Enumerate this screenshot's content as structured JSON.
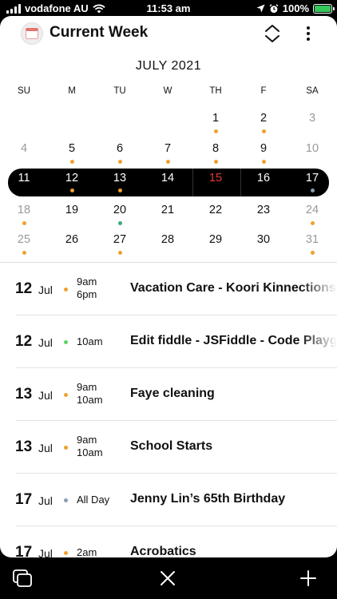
{
  "status": {
    "carrier": "vodafone AU",
    "time": "11:53 am",
    "battery": "100%",
    "battery_level": 1.0
  },
  "header": {
    "title": "Current Week",
    "icons": [
      "calendar-app-icon",
      "expand-collapse-icon",
      "more-vertical-icon"
    ]
  },
  "calendar": {
    "month_title": "JULY 2021",
    "weekdays": [
      "SU",
      "M",
      "TU",
      "W",
      "TH",
      "F",
      "SA"
    ],
    "weeks": [
      [
        null,
        null,
        null,
        null,
        {
          "d": "1",
          "dot": "orange"
        },
        {
          "d": "2",
          "dot": "orange"
        },
        {
          "d": "3",
          "muted": true
        }
      ],
      [
        {
          "d": "4",
          "muted": true
        },
        {
          "d": "5",
          "dot": "orange"
        },
        {
          "d": "6",
          "dot": "orange"
        },
        {
          "d": "7",
          "dot": "orange"
        },
        {
          "d": "8",
          "dot": "orange"
        },
        {
          "d": "9",
          "dot": "orange"
        },
        {
          "d": "10",
          "muted": true
        }
      ],
      [
        {
          "d": "11"
        },
        {
          "d": "12",
          "dot": "orange"
        },
        {
          "d": "13",
          "dot": "orange"
        },
        {
          "d": "14"
        },
        {
          "d": "15",
          "today": true
        },
        {
          "d": "16"
        },
        {
          "d": "17",
          "dot": "gray"
        }
      ],
      [
        {
          "d": "18",
          "muted": true,
          "dot": "orange"
        },
        {
          "d": "19"
        },
        {
          "d": "20",
          "dot": "green"
        },
        {
          "d": "21"
        },
        {
          "d": "22"
        },
        {
          "d": "23"
        },
        {
          "d": "24",
          "muted": true,
          "dot": "orange"
        }
      ],
      [
        {
          "d": "25",
          "muted": true,
          "dot": "orange"
        },
        {
          "d": "26"
        },
        {
          "d": "27",
          "dot": "orange"
        },
        {
          "d": "28"
        },
        {
          "d": "29"
        },
        {
          "d": "30"
        },
        {
          "d": "31",
          "muted": true,
          "dot": "orange"
        }
      ]
    ],
    "highlight_week": 2
  },
  "events": [
    {
      "day": "12",
      "month": "Jul",
      "dot": "orange",
      "times": [
        "9am",
        "6pm"
      ],
      "title": "Vacation Care - Koori Kinnections"
    },
    {
      "day": "12",
      "month": "Jul",
      "dot": "green",
      "times": [
        "10am"
      ],
      "title": "Edit fiddle - JSFiddle - Code Playground"
    },
    {
      "day": "13",
      "month": "Jul",
      "dot": "orange",
      "times": [
        "9am",
        "10am"
      ],
      "title": "Faye cleaning"
    },
    {
      "day": "13",
      "month": "Jul",
      "dot": "orange",
      "times": [
        "9am",
        "10am"
      ],
      "title": "School Starts"
    },
    {
      "day": "17",
      "month": "Jul",
      "dot": "gray",
      "times": [
        "All Day"
      ],
      "title": "Jenny Lin’s 65th Birthday"
    },
    {
      "day": "17",
      "month": "Jul",
      "dot": "orange",
      "times": [
        "2am"
      ],
      "title": "Acrobatics"
    }
  ],
  "colors": {
    "orange": "#f0a030",
    "green": "#3aa876",
    "event_green": "#5cd65c",
    "gray": "#8a9bb5",
    "today_red": "#e53935",
    "battery_green": "#34c759"
  },
  "bottom_bar": {
    "icons": [
      "tabs-icon",
      "close-icon",
      "add-icon"
    ]
  }
}
